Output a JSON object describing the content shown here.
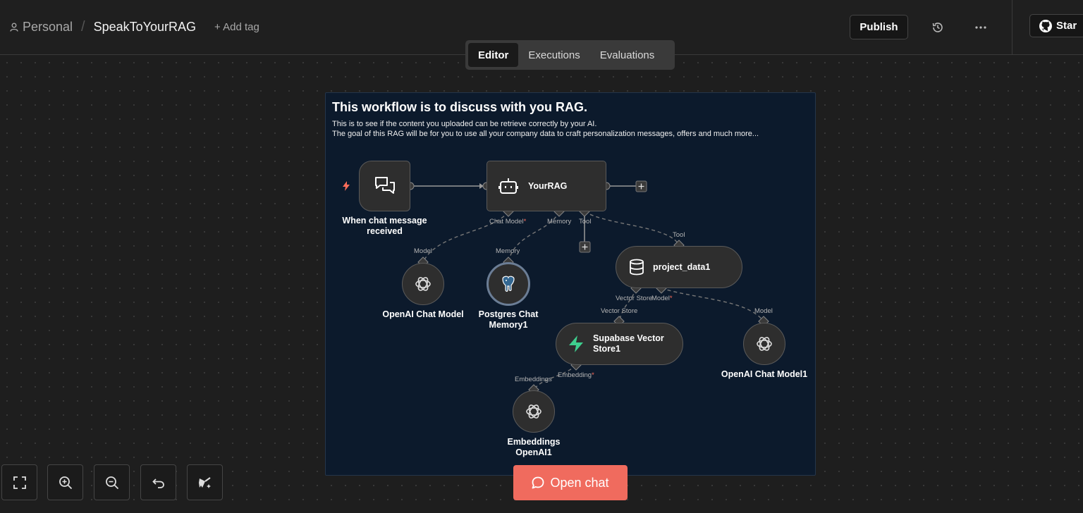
{
  "header": {
    "project": "Personal",
    "workflow_name": "SpeakToYourRAG",
    "add_tag": "+ Add tag",
    "publish": "Publish",
    "star": "Star"
  },
  "tabs": [
    {
      "label": "Editor",
      "active": true
    },
    {
      "label": "Executions",
      "active": false
    },
    {
      "label": "Evaluations",
      "active": false
    }
  ],
  "sticky_note": {
    "title": "This workflow is to discuss with you RAG.",
    "line1": "This is to see if the content you uploaded can be retrieve correctly by your AI.",
    "line2": "The goal of this RAG will be for you to use all your company data to craft personalization messages, offers and much more..."
  },
  "nodes": {
    "trigger": {
      "label_line1": "When chat message",
      "label_line2": "received"
    },
    "agent": {
      "label": "YourRAG"
    },
    "openai_model": {
      "label": "OpenAI Chat Model"
    },
    "postgres_memory": {
      "label_line1": "Postgres Chat",
      "label_line2": "Memory1"
    },
    "project_data": {
      "label": "project_data1"
    },
    "supabase": {
      "label_line1": "Supabase Vector",
      "label_line2": "Store1"
    },
    "openai_model1": {
      "label": "OpenAI Chat Model1"
    },
    "embeddings": {
      "label_line1": "Embeddings",
      "label_line2": "OpenAI1"
    }
  },
  "ports": {
    "chat_model": "Chat Model",
    "memory": "Memory",
    "tool": "Tool",
    "model": "Model",
    "memory_in": "Memory",
    "tool_in": "Tool",
    "vector_store_out": "Vector Store",
    "model_out": "Model",
    "vector_store_in": "Vector Store",
    "model_in": "Model",
    "embedding_out": "Embedding",
    "embeddings_in": "Embeddings",
    "required_mark": "*"
  },
  "open_chat": "Open chat",
  "colors": {
    "accent": "#f06b5e",
    "sticky_bg": "#0c1a2c",
    "supabase_green": "#3ecf8e",
    "trigger_bolt": "#ff6d5a"
  }
}
